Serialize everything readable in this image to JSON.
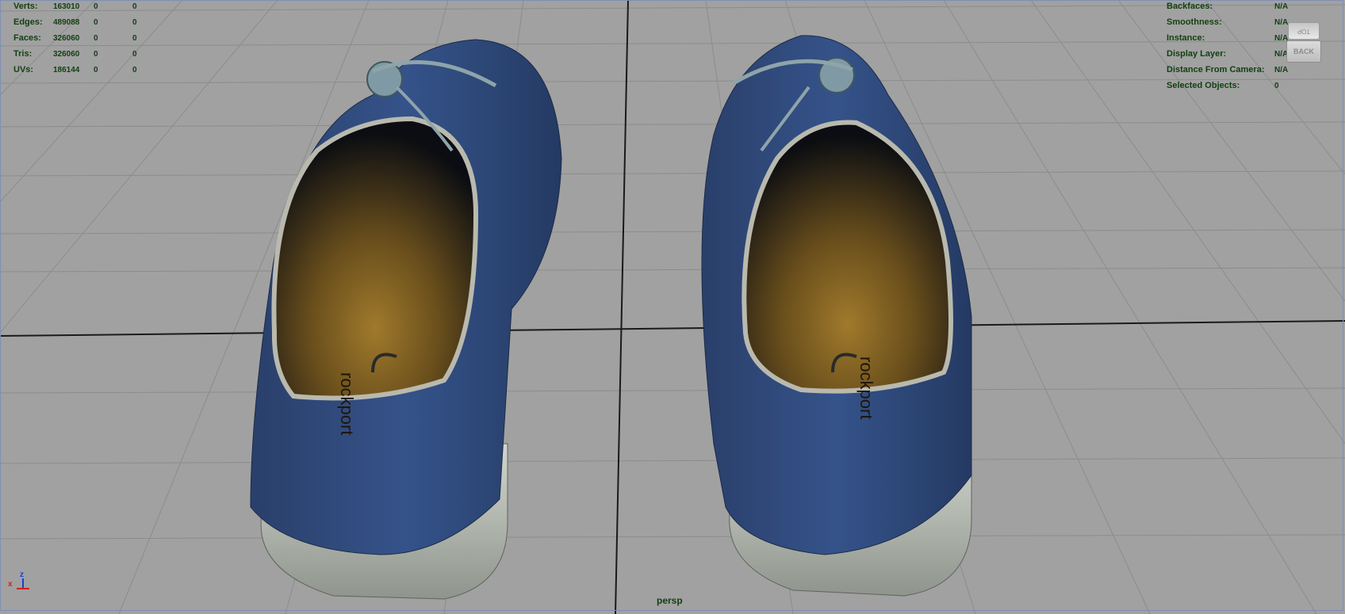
{
  "poly_stats": [
    {
      "label": "Verts:",
      "values": [
        "163010",
        "0",
        "0"
      ]
    },
    {
      "label": "Edges:",
      "values": [
        "489088",
        "0",
        "0"
      ]
    },
    {
      "label": "Faces:",
      "values": [
        "326060",
        "0",
        "0"
      ]
    },
    {
      "label": "Tris:",
      "values": [
        "326060",
        "0",
        "0"
      ]
    },
    {
      "label": "UVs:",
      "values": [
        "186144",
        "0",
        "0"
      ]
    }
  ],
  "object_info": [
    {
      "label": "Backfaces:",
      "value": "N/A"
    },
    {
      "label": "Smoothness:",
      "value": "N/A"
    },
    {
      "label": "Instance:",
      "value": "N/A"
    },
    {
      "label": "Display Layer:",
      "value": "N/A"
    },
    {
      "label": "Distance From Camera:",
      "value": "N/A"
    },
    {
      "label": "Selected Objects:",
      "value": "0"
    }
  ],
  "view_cube": {
    "top_label": "TOP",
    "back_label": "BACK"
  },
  "camera_label": "persp",
  "axis": {
    "x_label": "x",
    "z_label": "z"
  },
  "insole_brand": "rockport",
  "colors": {
    "viewport_bg": "#a1a1a1",
    "hud_text": "#123f12",
    "shoe_upper": "#2e4a7a",
    "shoe_sole": "#b9bfb5",
    "insole": "#8a6a28"
  }
}
